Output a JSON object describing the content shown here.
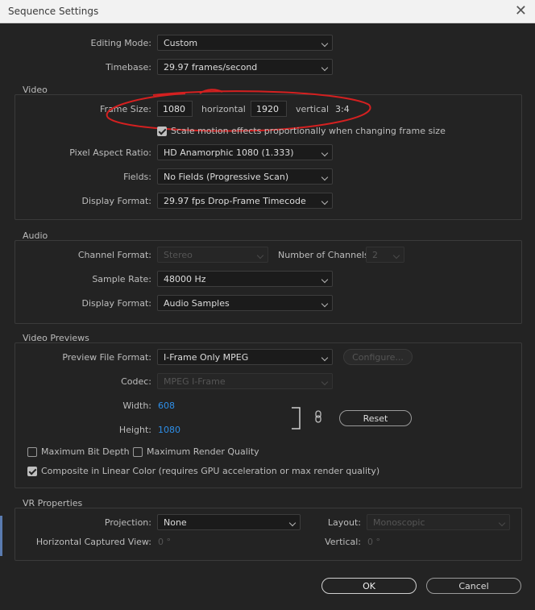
{
  "window": {
    "title": "Sequence Settings",
    "close": "✕"
  },
  "general": {
    "editing_mode_label": "Editing Mode:",
    "editing_mode_value": "Custom",
    "timebase_label": "Timebase:",
    "timebase_value": "29.97  frames/second"
  },
  "video": {
    "title": "Video",
    "frame_size_label": "Frame Size:",
    "width_value": "1080",
    "horizontal_label": "horizontal",
    "height_value": "1920",
    "vertical_label": "vertical",
    "aspect": "3:4",
    "scale_checkbox_label": "Scale motion effects proportionally when changing frame size",
    "scale_checked": true,
    "pixel_aspect_label": "Pixel Aspect Ratio:",
    "pixel_aspect_value": "HD Anamorphic 1080 (1.333)",
    "fields_label": "Fields:",
    "fields_value": "No Fields (Progressive Scan)",
    "display_format_label": "Display Format:",
    "display_format_value": "29.97 fps Drop-Frame Timecode"
  },
  "audio": {
    "title": "Audio",
    "channel_format_label": "Channel Format:",
    "channel_format_value": "Stereo",
    "num_channels_label": "Number of Channels:",
    "num_channels_value": "2",
    "sample_rate_label": "Sample Rate:",
    "sample_rate_value": "48000 Hz",
    "display_format_label": "Display Format:",
    "display_format_value": "Audio Samples"
  },
  "previews": {
    "title": "Video Previews",
    "preview_format_label": "Preview File Format:",
    "preview_format_value": "I-Frame Only MPEG",
    "configure_label": "Configure...",
    "codec_label": "Codec:",
    "codec_value": "MPEG I-Frame",
    "width_label": "Width:",
    "width_value": "608",
    "height_label": "Height:",
    "height_value": "1080",
    "reset_label": "Reset",
    "max_bit_depth_label": "Maximum Bit Depth",
    "max_render_quality_label": "Maximum Render Quality",
    "composite_label": "Composite in Linear Color (requires GPU acceleration or max render quality)",
    "composite_checked": true
  },
  "vr": {
    "title": "VR Properties",
    "projection_label": "Projection:",
    "projection_value": "None",
    "layout_label": "Layout:",
    "layout_value": "Monoscopic",
    "horizontal_view_label": "Horizontal Captured View:",
    "horizontal_view_value": "0 °",
    "vertical_label": "Vertical:",
    "vertical_value": "0 °"
  },
  "footer": {
    "ok_label": "OK",
    "cancel_label": "Cancel"
  },
  "colors": {
    "background": "#232323",
    "link_value": "#2e8fe8",
    "annotation": "#d42020"
  }
}
